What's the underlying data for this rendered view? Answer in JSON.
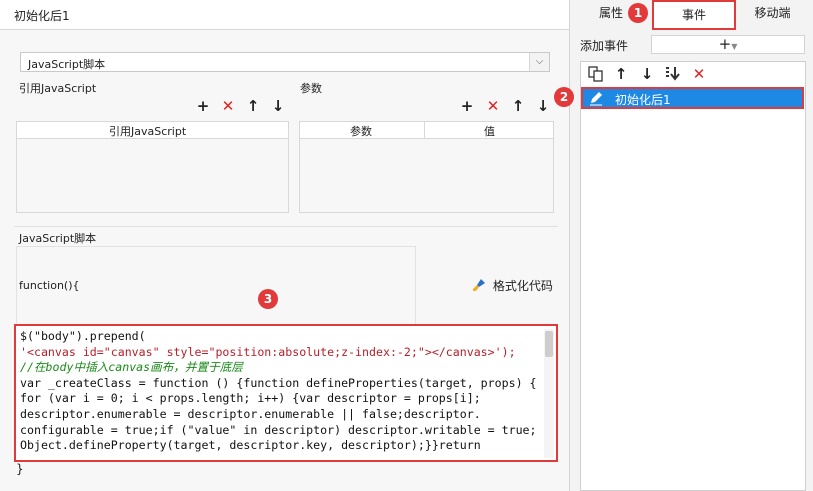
{
  "dialog": {
    "title": "初始化后1",
    "script_type": "JavaScript脚本",
    "ref_js_label": "引用JavaScript",
    "params_label": "参数",
    "ref_js_col": "引用JavaScript",
    "params_cols": [
      "参数",
      "值"
    ],
    "script_section_label": "JavaScript脚本",
    "function_header": "function(){",
    "format_code_label": "格式化代码",
    "closing_brace": "}"
  },
  "code_lines": [
    "$(\"body\").prepend(",
    "'<canvas id=\"canvas\" style=\"position:absolute;z-index:-2;\"></canvas>');",
    "//在body中插入canvas画布，并置于底层",
    "var _createClass = function () {function defineProperties(target, props) {",
    "for (var i = 0; i < props.length; i++) {var descriptor = props[i];",
    "descriptor.enumerable = descriptor.enumerable || false;descriptor.",
    "configurable = true;if (\"value\" in descriptor) descriptor.writable = true;",
    "Object.defineProperty(target, descriptor.key, descriptor);}}return"
  ],
  "right_panel": {
    "tabs": [
      "属性",
      "事件",
      "移动端"
    ],
    "active_tab": "事件",
    "add_event_label": "添加事件",
    "events": [
      "初始化后1"
    ]
  },
  "badges": [
    "1",
    "2",
    "3"
  ],
  "icons": {
    "add": "plus-icon",
    "delete": "x-icon",
    "up": "arrow-up-icon",
    "down": "arrow-down-icon",
    "copy": "copy-icon",
    "move_bottom": "move-bottom-icon",
    "edit": "pencil-icon",
    "brush": "brush-icon",
    "dropdown": "chevron-down-icon"
  },
  "colors": {
    "accent_red": "#e03a3a",
    "selection_blue": "#1e88e5",
    "delete_red": "#e02424"
  }
}
